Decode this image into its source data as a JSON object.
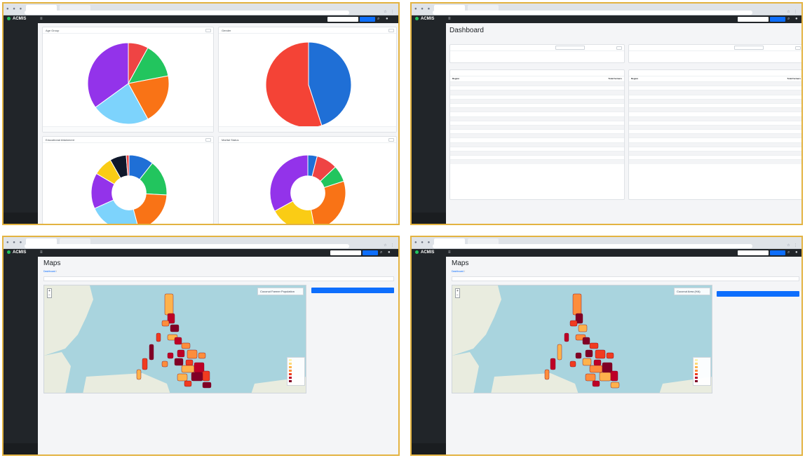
{
  "browser": {
    "tab1": "",
    "tab2": "",
    "url": ""
  },
  "app": {
    "brand": "ACMIS",
    "search_placeholder": "",
    "account_button": ""
  },
  "sidebar": {
    "items": [
      "",
      "",
      "",
      "",
      "",
      "",
      "",
      "",
      ""
    ],
    "footer": ""
  },
  "panel1": {
    "cards": [
      {
        "title": "Age Group",
        "footer": "",
        "download": "",
        "chart_data": {
          "type": "pie",
          "values": [
            8,
            14,
            20,
            23,
            35
          ],
          "colors": [
            "#ef4444",
            "#22c55e",
            "#f97316",
            "#7dd3fc",
            "#9333ea"
          ],
          "title": "Age Group"
        }
      },
      {
        "title": "Gender",
        "footer": "",
        "download": "",
        "chart_data": {
          "type": "pie",
          "values": [
            45,
            55
          ],
          "colors": [
            "#1f6fd6",
            "#f44336"
          ],
          "title": "Gender"
        }
      },
      {
        "title": "Educational Attainment",
        "footer": "",
        "download": "",
        "chart_data": {
          "type": "pie",
          "donut": true,
          "values": [
            9,
            13,
            17,
            19,
            13,
            7,
            6,
            1
          ],
          "colors": [
            "#1f6fd6",
            "#22c55e",
            "#f97316",
            "#7dd3fc",
            "#9333ea",
            "#facc15",
            "#0f172a",
            "#ef4444"
          ],
          "title": "Educational Attainment"
        }
      },
      {
        "title": "Marital Status",
        "footer": "",
        "download": "",
        "chart_data": {
          "type": "pie",
          "donut": true,
          "values": [
            4,
            9,
            7,
            27,
            20,
            33
          ],
          "colors": [
            "#1f6fd6",
            "#ef4444",
            "#22c55e",
            "#f97316",
            "#facc15",
            "#9333ea"
          ],
          "title": "Marital Status"
        }
      }
    ]
  },
  "panel2": {
    "title": "Dashboard",
    "crumb": "",
    "filters": [
      {
        "label": "",
        "select": "",
        "button": ""
      },
      {
        "label": "",
        "select": "",
        "button": ""
      }
    ],
    "table1": {
      "title": "",
      "headers": [
        "Region",
        "Total Farmers"
      ],
      "rows": [
        [
          "",
          ""
        ],
        [
          "",
          ""
        ],
        [
          "",
          ""
        ],
        [
          "",
          ""
        ],
        [
          "",
          ""
        ],
        [
          "",
          ""
        ],
        [
          "",
          ""
        ],
        [
          "",
          ""
        ],
        [
          "",
          ""
        ],
        [
          "",
          ""
        ],
        [
          "",
          ""
        ],
        [
          "",
          ""
        ],
        [
          "",
          ""
        ],
        [
          "",
          ""
        ],
        [
          "",
          ""
        ],
        [
          "",
          ""
        ],
        [
          "",
          ""
        ],
        [
          "",
          ""
        ],
        [
          "",
          ""
        ]
      ]
    },
    "table2": {
      "title": "",
      "headers": [
        "Region",
        "Total Farmers"
      ],
      "rows": [
        [
          "",
          ""
        ],
        [
          "",
          ""
        ],
        [
          "",
          ""
        ],
        [
          "",
          ""
        ],
        [
          "",
          ""
        ],
        [
          "",
          ""
        ],
        [
          "",
          ""
        ],
        [
          "",
          ""
        ],
        [
          "",
          ""
        ],
        [
          "",
          ""
        ],
        [
          "",
          ""
        ],
        [
          "",
          ""
        ],
        [
          "",
          ""
        ],
        [
          "",
          ""
        ],
        [
          "",
          ""
        ],
        [
          "",
          ""
        ],
        [
          "",
          ""
        ],
        [
          "",
          ""
        ],
        [
          "",
          ""
        ]
      ]
    },
    "footer_left": "",
    "footer_right": ""
  },
  "panel3": {
    "title": "Maps",
    "crumb_link": "Dashboard",
    "crumb_current": "",
    "map_search": "",
    "info_title": "Coconut Farmer Population",
    "info_sub": "",
    "primary_button": "",
    "secondary_link": "",
    "caption": "",
    "footer_left": "",
    "footer_right": ""
  },
  "panel4": {
    "title": "Maps",
    "crumb_link": "Dashboard",
    "crumb_current": "",
    "map_search": "",
    "info_title": "Coconut Area (HA)",
    "info_sub": "",
    "primary_link": "",
    "secondary_button": "",
    "caption": "",
    "footer_left": "",
    "footer_right": ""
  },
  "map_legend": {
    "colors": [
      "#fff3b0",
      "#fed976",
      "#feb24c",
      "#fd8d3c",
      "#f03b20",
      "#bd0026",
      "#800026"
    ]
  }
}
